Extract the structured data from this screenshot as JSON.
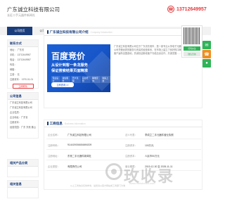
{
  "header": {
    "company_name": "广东诚立科技有限公司",
    "subtitle": "长征二手元器件新闻社",
    "phone": "13712649957"
  },
  "nav": {
    "items": [
      "公司首页",
      "公司介绍",
      "供应信息",
      "求购信息",
      "公司新闻",
      "资质证书",
      "公司相册",
      "联系我们"
    ],
    "active_index": 0
  },
  "sidebar": {
    "contact": {
      "title": "联系方式",
      "lines": [
        "地址：  广东省",
        "手机：  13712649957",
        "电话：  13712649957",
        "传真：",
        "邮箱：",
        "主营：  无",
        "注册资本：  1970-01-01"
      ],
      "button": "立即联系"
    },
    "profile": {
      "title": "公司信息",
      "lines": [
        "广东诚立科技有限公司",
        "广东诚立科技有限公司",
        "企业性质：",
        "企业地址：广东省",
        "注册资本：",
        "经营范围：广东 东莞 佛山"
      ]
    },
    "products": {
      "title": "相关产品分类"
    },
    "other": {
      "title": "相关信息"
    }
  },
  "intro": {
    "title": "广东诚立科技有限公司介绍",
    "subtitle": "Company Introduction",
    "text": "广东诚立科技有限公司位于广东省东莞市，是一家专业从事电子元器件的综合型企业。公司凭借优质的服务与完善的经营体系，在市场上建立了良好的口碑与信誉，长期合作客户遍布全国各地，热诚欢迎新老客户光临洽谈合作，共谋发展……",
    "more": "【查看详细】"
  },
  "ad": {
    "title": "百度竞价",
    "line1": "从设计到客一条龙服务",
    "line2": "保证搜索结果页面精准",
    "tags": [
      "专业设计",
      "诚信服务",
      "开户流程",
      "后台托管",
      "精准定向",
      "快速上线"
    ],
    "button": "立即咨询 >>"
  },
  "business": {
    "title": "工商信息",
    "subtitle": "Business Information",
    "rows": [
      [
        [
          "企业名称：",
          "广东诚立科技有限公司"
        ],
        [
          "法人代表：",
          "李成立二手元器件营业执照"
        ]
      ],
      [
        [
          "注册号码：",
          "914419006654MNG09"
        ],
        [
          "注册资本：",
          "100万元"
        ]
      ],
      [
        [
          "注册地址：",
          "东莞二手元器件新闻社"
        ],
        [
          "注册资本：",
          "人民币50万元"
        ]
      ],
      [
        [
          "企业类型：",
          "有限责任公司"
        ],
        [
          "营业期限：",
          "2019-12-30 至 2028-11-11"
        ]
      ]
    ],
    "note": "以上工商信息仅供参考，最终请以官方网站或工商部门为准"
  },
  "watermark": {
    "text": "玫收录",
    "sub": "www.meishoulu.com"
  },
  "float": {
    "qr_follow": "扫码关注",
    "qr_wechat": "微信咨询",
    "online": "在线",
    "phone": "电话",
    "wechat": "微信"
  },
  "colors": {
    "brand": "#1a3d7c",
    "accent": "#e4393c",
    "ad_blue": "#1756c9",
    "green": "#2fb457"
  }
}
